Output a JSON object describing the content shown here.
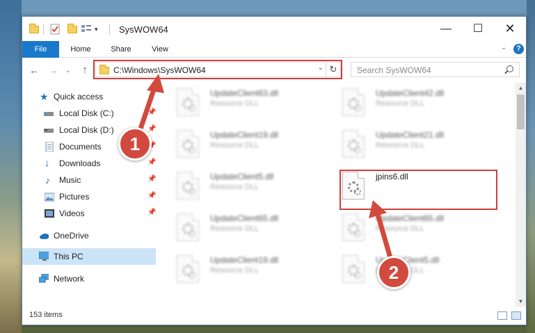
{
  "window": {
    "title": "SysWOW64"
  },
  "ribbon": {
    "tabs": [
      "File",
      "Home",
      "Share",
      "View"
    ]
  },
  "address": {
    "path": "C:\\Windows\\SysWOW64",
    "search_placeholder": "Search SysWOW64"
  },
  "nav": {
    "items": [
      {
        "label": "Quick access",
        "icon": "star-icon",
        "pinned": false
      },
      {
        "label": "Local Disk (C:)",
        "icon": "drive-icon",
        "pinned": true
      },
      {
        "label": "Local Disk (D:)",
        "icon": "drive-icon",
        "pinned": true
      },
      {
        "label": "Documents",
        "icon": "documents-icon",
        "pinned": true
      },
      {
        "label": "Downloads",
        "icon": "download-icon",
        "pinned": true
      },
      {
        "label": "Music",
        "icon": "music-icon",
        "pinned": true
      },
      {
        "label": "Pictures",
        "icon": "pictures-icon",
        "pinned": true
      },
      {
        "label": "Videos",
        "icon": "videos-icon",
        "pinned": true
      },
      {
        "label": "OneDrive",
        "icon": "cloud-icon",
        "pinned": false
      },
      {
        "label": "This PC",
        "icon": "computer-icon",
        "pinned": false,
        "selected": true
      },
      {
        "label": "Network",
        "icon": "network-icon",
        "pinned": false
      }
    ]
  },
  "files": [
    {
      "name": "UpdateClient63.dll",
      "type": "Resource DLL",
      "blurred": true
    },
    {
      "name": "UpdateClient42.dll",
      "type": "Resource DLL",
      "blurred": true
    },
    {
      "name": "UpdateClient19.dll",
      "type": "Resource DLL",
      "blurred": true
    },
    {
      "name": "UpdateClient21.dll",
      "type": "Resource DLL",
      "blurred": true
    },
    {
      "name": "UpdateClient5.dll",
      "type": "Resource DLL",
      "blurred": true
    },
    {
      "name": "jpins6.dll",
      "type": "",
      "blurred": false,
      "highlighted": true
    },
    {
      "name": "UpdateClient65.dll",
      "type": "Resource DLL",
      "blurred": true
    },
    {
      "name": "UpdateClient65.dll",
      "type": "Resource DLL",
      "blurred": true
    },
    {
      "name": "UpdateClient19.dll",
      "type": "Resource DLL",
      "blurred": true
    },
    {
      "name": "UpdateClient5.dll",
      "type": "Resource DLL",
      "blurred": true
    }
  ],
  "status": {
    "item_count": "153 items"
  },
  "annotations": {
    "badge1": "1",
    "badge2": "2",
    "color": "#d24a3d"
  }
}
